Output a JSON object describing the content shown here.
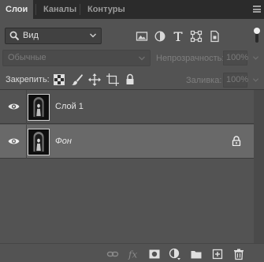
{
  "tabs": [
    {
      "label": "Слои",
      "active": true
    },
    {
      "label": "Каналы",
      "active": false
    },
    {
      "label": "Контуры",
      "active": false
    }
  ],
  "filter": {
    "kind_label": "Вид",
    "icons": [
      "image-filter-icon",
      "adjustment-filter-icon",
      "type-filter-icon",
      "shape-filter-icon",
      "smart-object-filter-icon"
    ]
  },
  "blend": {
    "mode": "Обычные",
    "opacity_label": "Непрозрачность:",
    "opacity_value": "100%"
  },
  "lock": {
    "label": "Закрепить:",
    "fill_label": "Заливка:",
    "fill_value": "100%"
  },
  "layers": [
    {
      "name": "Слой 1",
      "visible": true,
      "selected": false,
      "locked": false
    },
    {
      "name": "Фон",
      "visible": true,
      "selected": true,
      "locked": true
    }
  ],
  "bottom_icons": [
    "link-layers-icon",
    "fx-icon",
    "add-mask-icon",
    "adjustment-layer-icon",
    "group-icon",
    "new-layer-icon",
    "trash-icon"
  ],
  "colors": {
    "panel_bg": "#535353",
    "tab_bar_bg": "#2b2b2b",
    "selected_layer_bg": "#696969"
  }
}
